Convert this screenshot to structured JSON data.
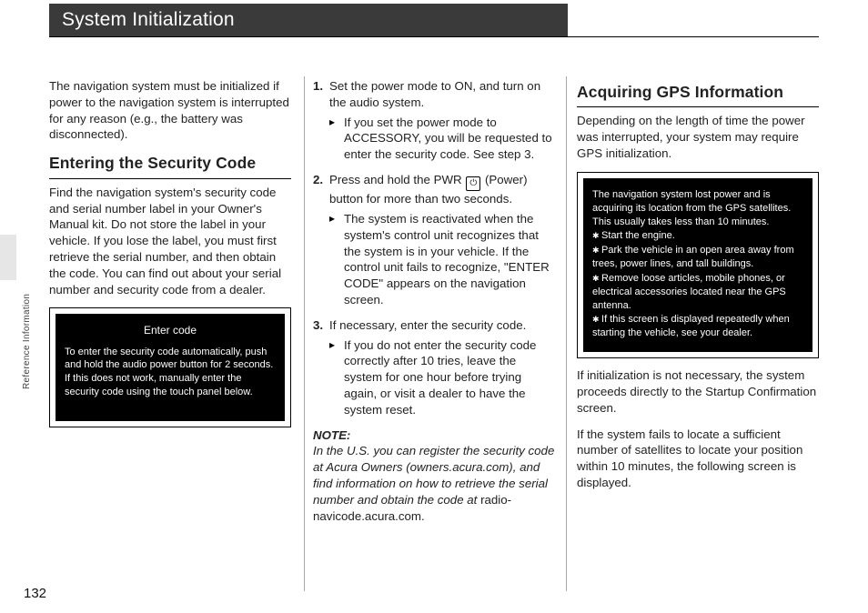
{
  "page": {
    "title": "System Initialization",
    "side_label": "Reference Information",
    "number": "132"
  },
  "col1": {
    "intro": "The navigation system must be initialized if power to the navigation system is interrupted for any reason (e.g., the battery was disconnected).",
    "h_security": "Entering the Security Code",
    "security_body": "Find the navigation system's security code and serial number label in your Owner's Manual kit. Do not store the label in your vehicle. If you lose the label, you must first retrieve the serial number, and then obtain the code. You can find out about your serial number and security code from a dealer.",
    "screen": {
      "title": "Enter code",
      "line1": "To enter the security code automatically, push and hold the audio power button for 2 seconds. If this does not work, manually enter the security code using the touch panel below."
    }
  },
  "col2": {
    "s1": "Set the power mode to ON, and turn on the audio system.",
    "s1_sub": "If you set the power mode to ACCESSORY, you will be requested to enter the security code. See step 3.",
    "s2a": "Press and hold the PWR ",
    "s2b": " (Power) button for more than two seconds.",
    "s2_sub": "The system is reactivated when the system's control unit recognizes that the system is in your vehicle. If the control unit fails to recognize, \"ENTER CODE\" appears on the navigation screen.",
    "s3": "If necessary, enter the security code.",
    "s3_sub": "If you do not enter the security code correctly after 10 tries, leave the system for one hour before trying again, or visit a dealer to have the system reset.",
    "note_hd": "NOTE:",
    "note_body_i": "In the U.S. you can register the security code at Acura Owners (owners.acura.com), and find information on how to retrieve the serial number and obtain the code at ",
    "note_body_r": "radio-navicode.acura.com."
  },
  "col3": {
    "h_gps": "Acquiring GPS Information",
    "gps_intro": "Depending on the length of time the power was interrupted, your system may require GPS initialization.",
    "screen": {
      "l1": "The navigation system lost power and is acquiring its location from the GPS satellites. This usually takes less than 10 minutes.",
      "l2": "Start the engine.",
      "l3": "Park the vehicle in an open area away from trees, power lines, and tall buildings.",
      "l4": "Remove loose articles, mobile phones, or electrical accessories located near the GPS antenna.",
      "l5": "If this screen is displayed repeatedly when starting the vehicle, see your dealer."
    },
    "p2": "If initialization is not necessary, the system proceeds directly to the Startup Confirmation screen.",
    "p3": "If the system fails to locate a sufficient number of satellites to locate your position within 10 minutes, the following screen is displayed."
  }
}
